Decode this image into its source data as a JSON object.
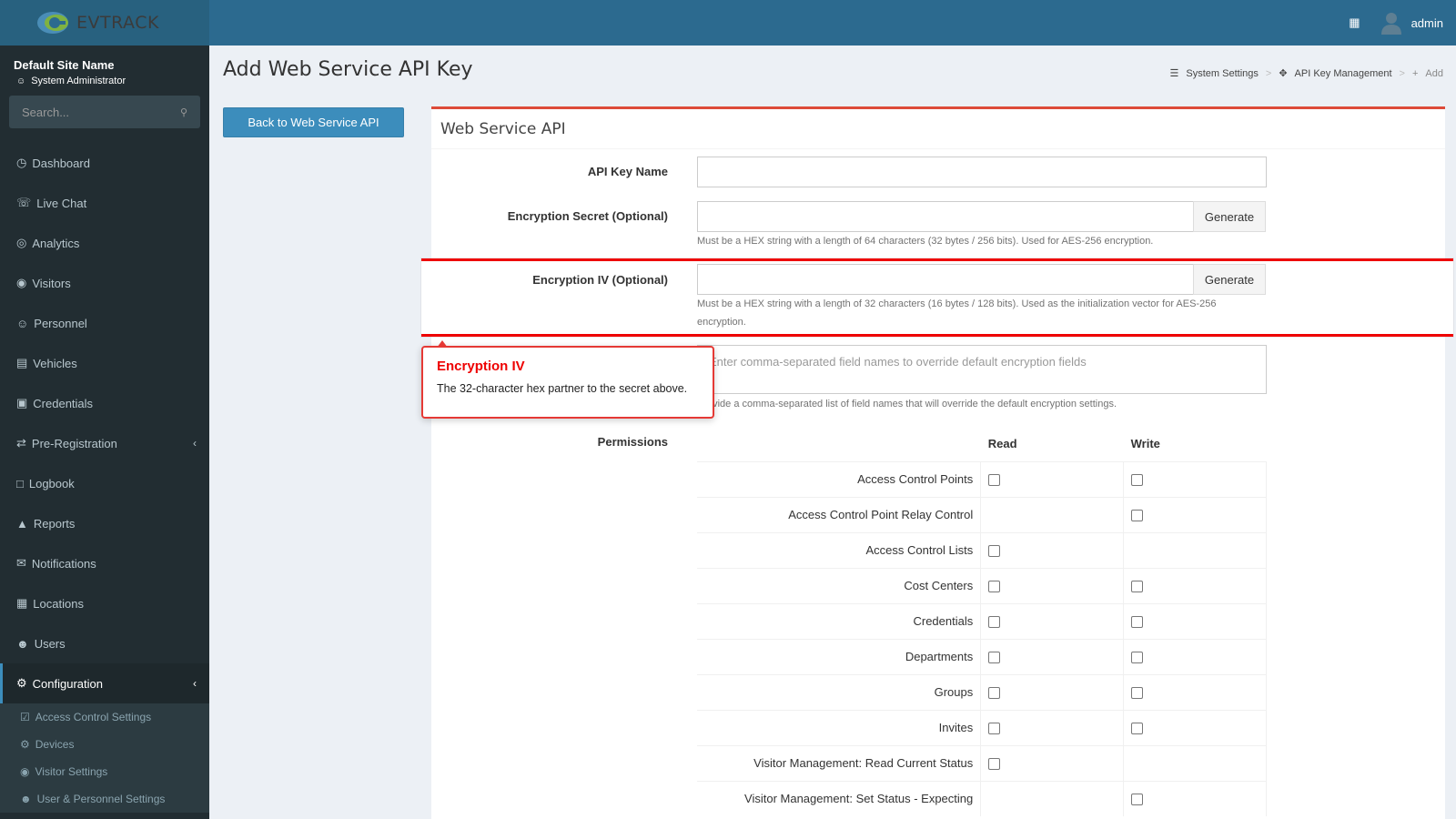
{
  "app": {
    "brand": "EVTRACK",
    "user": "admin"
  },
  "sidebar": {
    "site_name": "Default Site Name",
    "role": "System Administrator",
    "search_placeholder": "Search...",
    "items": [
      {
        "label": "Dashboard",
        "icon": "dashboard-icon"
      },
      {
        "label": "Live Chat",
        "icon": "headset-icon"
      },
      {
        "label": "Analytics",
        "icon": "target-icon"
      },
      {
        "label": "Visitors",
        "icon": "eye-icon"
      },
      {
        "label": "Personnel",
        "icon": "person-icon"
      },
      {
        "label": "Vehicles",
        "icon": "car-icon"
      },
      {
        "label": "Credentials",
        "icon": "id-card-icon"
      },
      {
        "label": "Pre-Registration",
        "icon": "exchange-icon"
      },
      {
        "label": "Logbook",
        "icon": "book-icon"
      },
      {
        "label": "Reports",
        "icon": "chart-icon"
      },
      {
        "label": "Notifications",
        "icon": "comments-icon"
      },
      {
        "label": "Locations",
        "icon": "map-icon"
      },
      {
        "label": "Users",
        "icon": "users-icon"
      },
      {
        "label": "Configuration",
        "icon": "gear-icon"
      }
    ],
    "subitems": [
      {
        "label": "Access Control Settings",
        "icon": "lock-icon"
      },
      {
        "label": "Devices",
        "icon": "cog-icon"
      },
      {
        "label": "Visitor Settings",
        "icon": "eye-icon"
      },
      {
        "label": "User & Personnel Settings",
        "icon": "users-icon"
      }
    ]
  },
  "page": {
    "title": "Add Web Service API Key",
    "back_button": "Back to Web Service API",
    "breadcrumb": [
      "System Settings",
      "API Key Management",
      "Add"
    ]
  },
  "form": {
    "panel_title": "Web Service API",
    "api_key_name_label": "API Key Name",
    "secret_label": "Encryption Secret (Optional)",
    "secret_help": "Must be a HEX string with a length of 64 characters (32 bytes / 256 bits). Used for AES-256 encryption.",
    "iv_label": "Encryption IV (Optional)",
    "iv_help": "Must be a HEX string with a length of 32 characters (16 bytes / 128 bits). Used as the initialization vector for AES-256 encryption.",
    "generate_label": "Generate",
    "fields_placeholder": "Enter comma-separated field names to override default encryption fields",
    "fields_help": "Provide a comma-separated list of field names that will override the default encryption settings.",
    "permissions_label": "Permissions",
    "read_header": "Read",
    "write_header": "Write",
    "permissions": [
      {
        "name": "Access Control Points",
        "read": true,
        "write": true
      },
      {
        "name": "Access Control Point Relay Control",
        "read": false,
        "write": true
      },
      {
        "name": "Access Control Lists",
        "read": true,
        "write": false
      },
      {
        "name": "Cost Centers",
        "read": true,
        "write": true
      },
      {
        "name": "Credentials",
        "read": true,
        "write": true
      },
      {
        "name": "Departments",
        "read": true,
        "write": true
      },
      {
        "name": "Groups",
        "read": true,
        "write": true
      },
      {
        "name": "Invites",
        "read": true,
        "write": true
      },
      {
        "name": "Visitor Management: Read Current Status",
        "read": true,
        "write": false
      },
      {
        "name": "Visitor Management: Set Status - Expecting",
        "read": false,
        "write": true
      }
    ]
  },
  "tooltip": {
    "title": "Encryption IV",
    "body": "The 32-character hex partner to the secret above."
  },
  "colors": {
    "topbar": "#2c6a8f",
    "sidebar": "#222d32",
    "accent": "#3c8dbc",
    "highlight": "#e00000"
  }
}
